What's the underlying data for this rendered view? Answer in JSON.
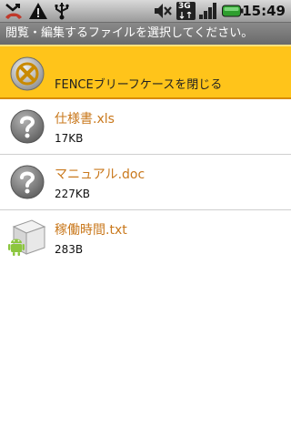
{
  "status_bar": {
    "time": "15:49",
    "network_label": "3G",
    "icons": [
      "missed-call-icon",
      "warning-icon",
      "usb-icon",
      "mute-icon",
      "3g-icon",
      "signal-icon",
      "battery-icon"
    ]
  },
  "header": {
    "title": "閲覧・編集するファイルを選択してください。"
  },
  "close_item": {
    "label": "FENCEブリーフケースを閉じる",
    "icon": "close-icon"
  },
  "files": [
    {
      "name": "仕様書.xls",
      "size": "17KB",
      "icon": "unknown-file-icon"
    },
    {
      "name": "マニュアル.doc",
      "size": "227KB",
      "icon": "unknown-file-icon"
    },
    {
      "name": "稼働時間.txt",
      "size": "283B",
      "icon": "android-package-icon"
    }
  ],
  "colors": {
    "accent_orange": "#ffc41a",
    "file_name_text": "#c9781c"
  }
}
